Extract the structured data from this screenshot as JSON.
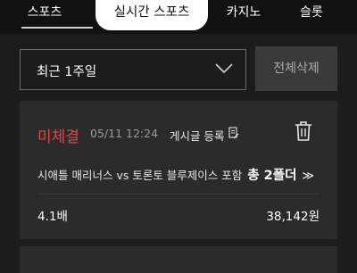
{
  "tabs": [
    {
      "label": "스포츠"
    },
    {
      "label": "실시간 스포츠"
    },
    {
      "label": "카지노"
    },
    {
      "label": "슬롯"
    }
  ],
  "filter": {
    "date_range": "최근 1주일",
    "delete_all": "전체삭제"
  },
  "bet": {
    "status": "미체결",
    "datetime": "05/11 12:24",
    "post_label": "게시글 등록",
    "match": "시애틀 매리너스 vs 토론토 블루제이스 포함",
    "fold": "총 2폴더",
    "fold_chevron": "≫",
    "odds": "4.1배",
    "amount": "38,142원"
  },
  "colors": {
    "background": "#1c1c1c",
    "card": "#2b2b2b",
    "status_red": "#e0474c"
  }
}
